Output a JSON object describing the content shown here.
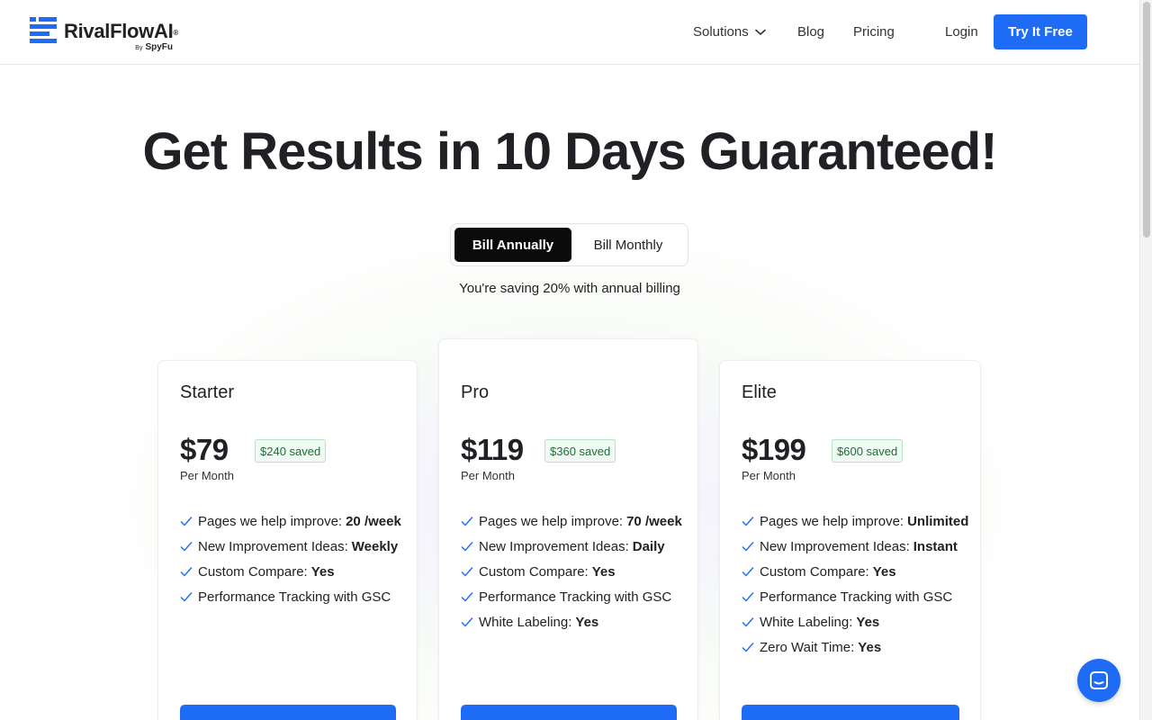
{
  "brand": {
    "name_main": "RivalFlow",
    "name_ai": "AI",
    "registered": "®",
    "by_label": "By",
    "by_company": "SpyFu",
    "accent_color": "#1e6bf5"
  },
  "nav": {
    "solutions": "Solutions",
    "blog": "Blog",
    "pricing": "Pricing",
    "login": "Login",
    "cta": "Try It Free"
  },
  "hero": {
    "title": "Get Results in 10 Days Guaranteed!"
  },
  "billing": {
    "annual": "Bill Annually",
    "monthly": "Bill Monthly",
    "selected": "Bill Annually",
    "saving_note": "You're saving 20% with annual billing"
  },
  "plans": [
    {
      "name": "Starter",
      "price": "$79",
      "saved": "$240 saved",
      "period": "Per Month",
      "features": [
        {
          "label": "Pages we help improve:",
          "value": "20 /week"
        },
        {
          "label": "New Improvement Ideas:",
          "value": "Weekly"
        },
        {
          "label": "Custom Compare:",
          "value": "Yes"
        },
        {
          "label": "Performance Tracking with GSC",
          "value": ""
        }
      ]
    },
    {
      "name": "Pro",
      "price": "$119",
      "saved": "$360 saved",
      "period": "Per Month",
      "features": [
        {
          "label": "Pages we help improve:",
          "value": "70 /week"
        },
        {
          "label": "New Improvement Ideas:",
          "value": "Daily"
        },
        {
          "label": "Custom Compare:",
          "value": "Yes"
        },
        {
          "label": "Performance Tracking with GSC",
          "value": ""
        },
        {
          "label": "White Labeling:",
          "value": "Yes"
        }
      ]
    },
    {
      "name": "Elite",
      "price": "$199",
      "saved": "$600 saved",
      "period": "Per Month",
      "features": [
        {
          "label": "Pages we help improve:",
          "value": "Unlimited"
        },
        {
          "label": "New Improvement Ideas:",
          "value": "Instant"
        },
        {
          "label": "Custom Compare:",
          "value": "Yes"
        },
        {
          "label": "Performance Tracking with GSC",
          "value": ""
        },
        {
          "label": "White Labeling:",
          "value": "Yes"
        },
        {
          "label": "Zero Wait Time:",
          "value": "Yes"
        }
      ]
    }
  ],
  "icons": {
    "logo": "stacked-bars-logo-icon",
    "dropdown": "chevron-down-icon",
    "feature": "checkmark-icon",
    "chat": "chat-bubble-icon"
  }
}
